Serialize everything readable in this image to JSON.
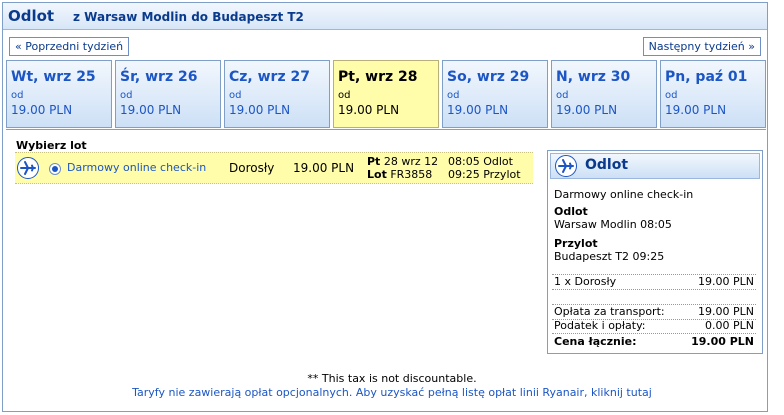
{
  "header": {
    "title": "Odlot",
    "route": "z Warsaw Modlin do Budapeszt T2"
  },
  "nav": {
    "prev": "« Poprzedni tydzień",
    "next": "Następny tydzień »"
  },
  "days": [
    {
      "label": "Wt, wrz 25",
      "od": "od",
      "price": "19.00 PLN",
      "selected": false
    },
    {
      "label": "Śr, wrz 26",
      "od": "od",
      "price": "19.00 PLN",
      "selected": false
    },
    {
      "label": "Cz, wrz 27",
      "od": "od",
      "price": "19.00 PLN",
      "selected": false
    },
    {
      "label": "Pt, wrz 28",
      "od": "od",
      "price": "19.00 PLN",
      "selected": true
    },
    {
      "label": "So, wrz 29",
      "od": "od",
      "price": "19.00 PLN",
      "selected": false
    },
    {
      "label": "N, wrz 30",
      "od": "od",
      "price": "19.00 PLN",
      "selected": false
    },
    {
      "label": "Pn, paź 01",
      "od": "od",
      "price": "19.00 PLN",
      "selected": false
    }
  ],
  "select_flight": "Wybierz lot",
  "flight": {
    "fare": "Darmowy online check-in",
    "passenger": "Dorosły",
    "price": "19.00 PLN",
    "day_label": "Pt",
    "date": "28 wrz 12",
    "flight_label": "Lot",
    "flight_no": "FR3858",
    "dep": "08:05 Odlot",
    "arr": "09:25 Przylot"
  },
  "summary": {
    "title": "Odlot",
    "fare": "Darmowy online check-in",
    "dep_label": "Odlot",
    "dep_value": "Warsaw Modlin 08:05",
    "arr_label": "Przylot",
    "arr_value": "Budapeszt T2 09:25",
    "pax_label": "1 x Dorosły",
    "pax_price": "19.00 PLN",
    "transport_label": "Opłata za transport:",
    "transport_value": "19.00 PLN",
    "tax_label": "Podatek i opłaty:",
    "tax_value": "0.00 PLN",
    "total_label": "Cena łącznie:",
    "total_value": "19.00 PLN"
  },
  "notes": {
    "tax": "** This tax is not discountable.",
    "fees": "Taryfy nie zawierają opłat opcjonalnych. Aby uzyskać pełną listę opłat linii Ryanair, kliknij tutaj"
  },
  "icons": {
    "plane": "plane-icon"
  },
  "colors": {
    "accent": "#1c56c4",
    "selected": "#fffdaa",
    "border": "#7f9fc9"
  }
}
